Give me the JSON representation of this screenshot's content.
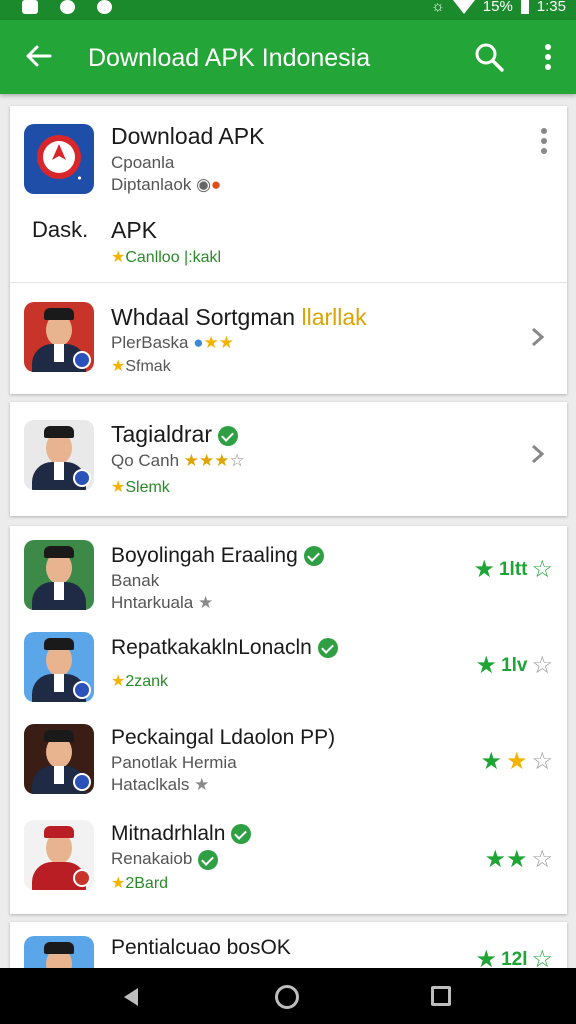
{
  "status_bar": {
    "battery": "15%",
    "time": "1:35"
  },
  "app_bar": {
    "title": "Download APK Indonesia",
    "back_icon": "arrow-back-icon",
    "search_icon": "search-icon",
    "menu_icon": "more-vert-icon"
  },
  "featured": {
    "title": "Download APK",
    "line1": "Cpoanla",
    "line2": "Diptanlaok",
    "section_label": "Dask.",
    "section_title": "APK",
    "section_meta": "Canlloo |:kakl"
  },
  "card2": {
    "title": "Whdaal Sortgman",
    "title_highlight": "llarllak",
    "sub": "PlerBaska",
    "meta": "Sfmak"
  },
  "card3": {
    "title": "Tagialdrar",
    "sub": "Qo Canh",
    "meta": "Slemk"
  },
  "list": [
    {
      "title": "Boyolingah Eraaling",
      "sub": "Banak",
      "sub2": "Hntarkuala",
      "rating_text": "1ltt"
    },
    {
      "title": "RepatkakaklnLonacln",
      "sub": "2zank",
      "rating_text": "1lv"
    },
    {
      "title": "Peckaingal Ldaolon PP)",
      "sub": "Panotlak Hermia",
      "sub2": "Hataclkals",
      "rating_text": ""
    },
    {
      "title": "Mitnadrhlaln",
      "sub": "Renakaiob",
      "sub2": "2Bard",
      "rating_text": ""
    },
    {
      "title": "Pentialcuao bosOK",
      "rating_text": "12l"
    }
  ],
  "colors": {
    "primary": "#23a637",
    "primary_dark": "#1b8a2c",
    "star_yellow": "#f2b400",
    "star_green": "#1ea536"
  }
}
